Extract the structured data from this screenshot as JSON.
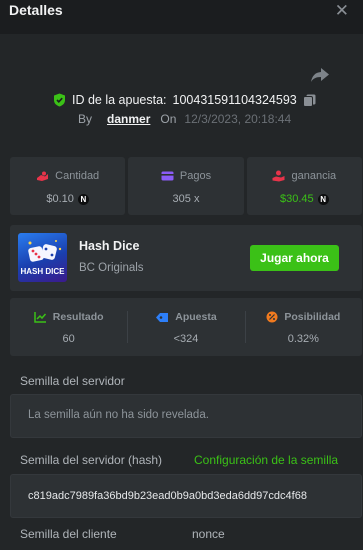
{
  "header": {
    "title": "Detalles",
    "close_glyph": "✕"
  },
  "bet": {
    "id_label": "ID de la apuesta:",
    "id_value": "100431591104324593",
    "by_label": "By",
    "user": "danmer",
    "on_label": "On",
    "date": "12/3/2023, 20:18:44"
  },
  "stats": {
    "amount_label": "Cantidad",
    "amount_value": "$0.10",
    "payout_label": "Pagos",
    "payout_value": "305 x",
    "profit_label": "ganancia",
    "profit_value": "$30.45",
    "coin_glyph": "N"
  },
  "game": {
    "name": "Hash Dice",
    "provider": "BC Originals",
    "play_label": "Jugar ahora",
    "thumb_text": "HASH DICE"
  },
  "results": {
    "result_label": "Resultado",
    "result_value": "60",
    "bet_label": "Apuesta",
    "bet_value": "<324",
    "chance_label": "Posibilidad",
    "chance_value": "0.32%"
  },
  "server_seed": {
    "label": "Semilla del servidor",
    "value": "La semilla aún no ha sido revelada."
  },
  "server_hash": {
    "label": "Semilla del servidor (hash)",
    "config_link": "Configuración de la semilla",
    "value": "c819adc7989fa36bd9b23ead0b9a0bd3eda6dd97cdc4f68"
  },
  "client_seed": {
    "label": "Semilla del cliente",
    "nonce_label": "nonce"
  },
  "colors": {
    "accent": "#3bc117",
    "background": "#232628",
    "panel": "#2d3134"
  }
}
